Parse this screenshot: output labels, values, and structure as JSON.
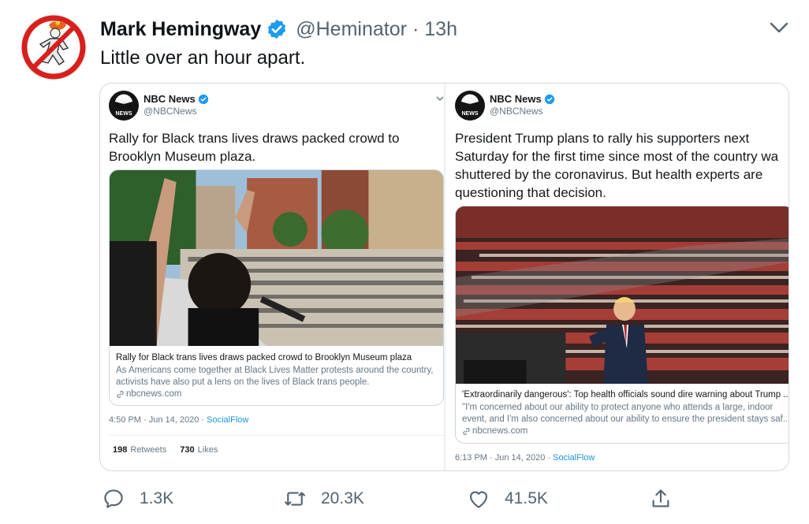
{
  "tweet": {
    "author_name": "Mark Hemingway",
    "handle": "@Heminator",
    "separator": "·",
    "time": "13h",
    "text": "Little over an hour apart."
  },
  "quotes": [
    {
      "source_name": "NBC News",
      "source_handle": "@NBCNews",
      "logo_text": "NEWS",
      "text_lines": [
        "Rally for Black trans lives draws packed crowd to",
        "Brooklyn Museum plaza."
      ],
      "card_title": "Rally for Black trans lives draws packed crowd to Brooklyn Museum plaza",
      "card_desc_lines": [
        "As Americans come together at Black Lives Matter protests around the country,",
        "activists have also put a lens on the lives of Black trans people."
      ],
      "card_domain": "nbcnews.com",
      "timestamp": "4:50 PM · Jun 14, 2020 · ",
      "source_app": "SocialFlow",
      "retweets": "198",
      "retweets_label": "Retweets",
      "likes": "730",
      "likes_label": "Likes"
    },
    {
      "source_name": "NBC News",
      "source_handle": "@NBCNews",
      "logo_text": "NEWS",
      "text_lines": [
        "President Trump plans to rally his supporters next",
        "Saturday for the first time since most of the country wa",
        "shuttered by the coronavirus. But health experts are",
        "questioning that decision."
      ],
      "card_title": "'Extraordinarily dangerous': Top health officials sound dire warning about Trump ...",
      "card_desc_lines": [
        "\"I'm concerned about our ability to protect anyone who attends a large, indoor",
        "event, and I'm also concerned about our ability to ensure the president stays saf..."
      ],
      "card_domain": "nbcnews.com",
      "timestamp": "6:13 PM · Jun 14, 2020 · ",
      "source_app": "SocialFlow"
    }
  ],
  "actions": {
    "reply_count": "1.3K",
    "retweet_count": "20.3K",
    "like_count": "41.5K"
  },
  "icons": {
    "verified": "verified-badge-icon",
    "more": "chevron-down-icon",
    "reply": "reply-icon",
    "retweet": "retweet-icon",
    "like": "heart-icon",
    "share": "share-icon",
    "link": "link-icon"
  },
  "colors": {
    "verified_blue": "#1d9bf0",
    "link_blue": "#1b95e0",
    "secondary_text": "#536471"
  }
}
